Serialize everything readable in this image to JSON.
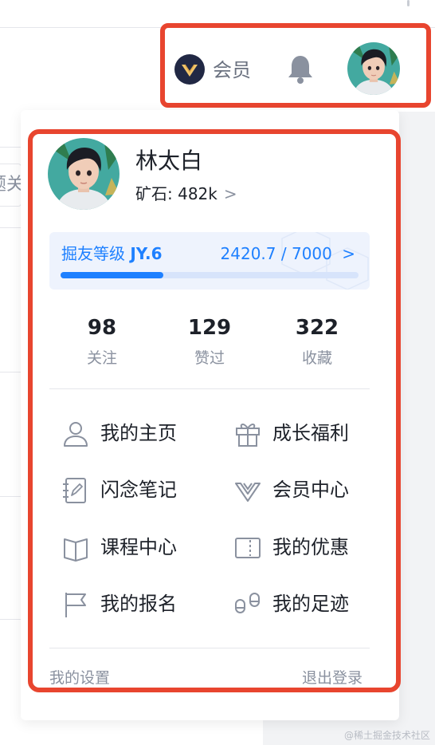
{
  "header": {
    "vip_label": "会员"
  },
  "background": {
    "chip_text": "题关"
  },
  "user": {
    "name": "林太白",
    "ore": "矿石: 482k",
    "ore_chevron": ">"
  },
  "level": {
    "title_prefix": "掘友等级 ",
    "level_code": "JY.6",
    "progress_text": "2420.7 / 7000",
    "chevron": ">",
    "progress_fraction": 0.3458
  },
  "stats": [
    {
      "value": "98",
      "label": "关注"
    },
    {
      "value": "129",
      "label": "赞过"
    },
    {
      "value": "322",
      "label": "收藏"
    }
  ],
  "menu": [
    {
      "label": "我的主页",
      "icon": "user-icon"
    },
    {
      "label": "成长福利",
      "icon": "gift-icon"
    },
    {
      "label": "闪念笔记",
      "icon": "note-icon"
    },
    {
      "label": "会员中心",
      "icon": "vip-icon"
    },
    {
      "label": "课程中心",
      "icon": "book-icon"
    },
    {
      "label": "我的优惠",
      "icon": "coupon-icon"
    },
    {
      "label": "我的报名",
      "icon": "flag-icon"
    },
    {
      "label": "我的足迹",
      "icon": "footprint-icon"
    }
  ],
  "footer": {
    "settings": "我的设置",
    "logout": "退出登录"
  },
  "watermark": "@稀土掘金技术社区",
  "colors": {
    "accent": "#1e80ff",
    "highlight": "#e8452f",
    "text_primary": "#1d2129",
    "text_secondary": "#8a919f"
  }
}
